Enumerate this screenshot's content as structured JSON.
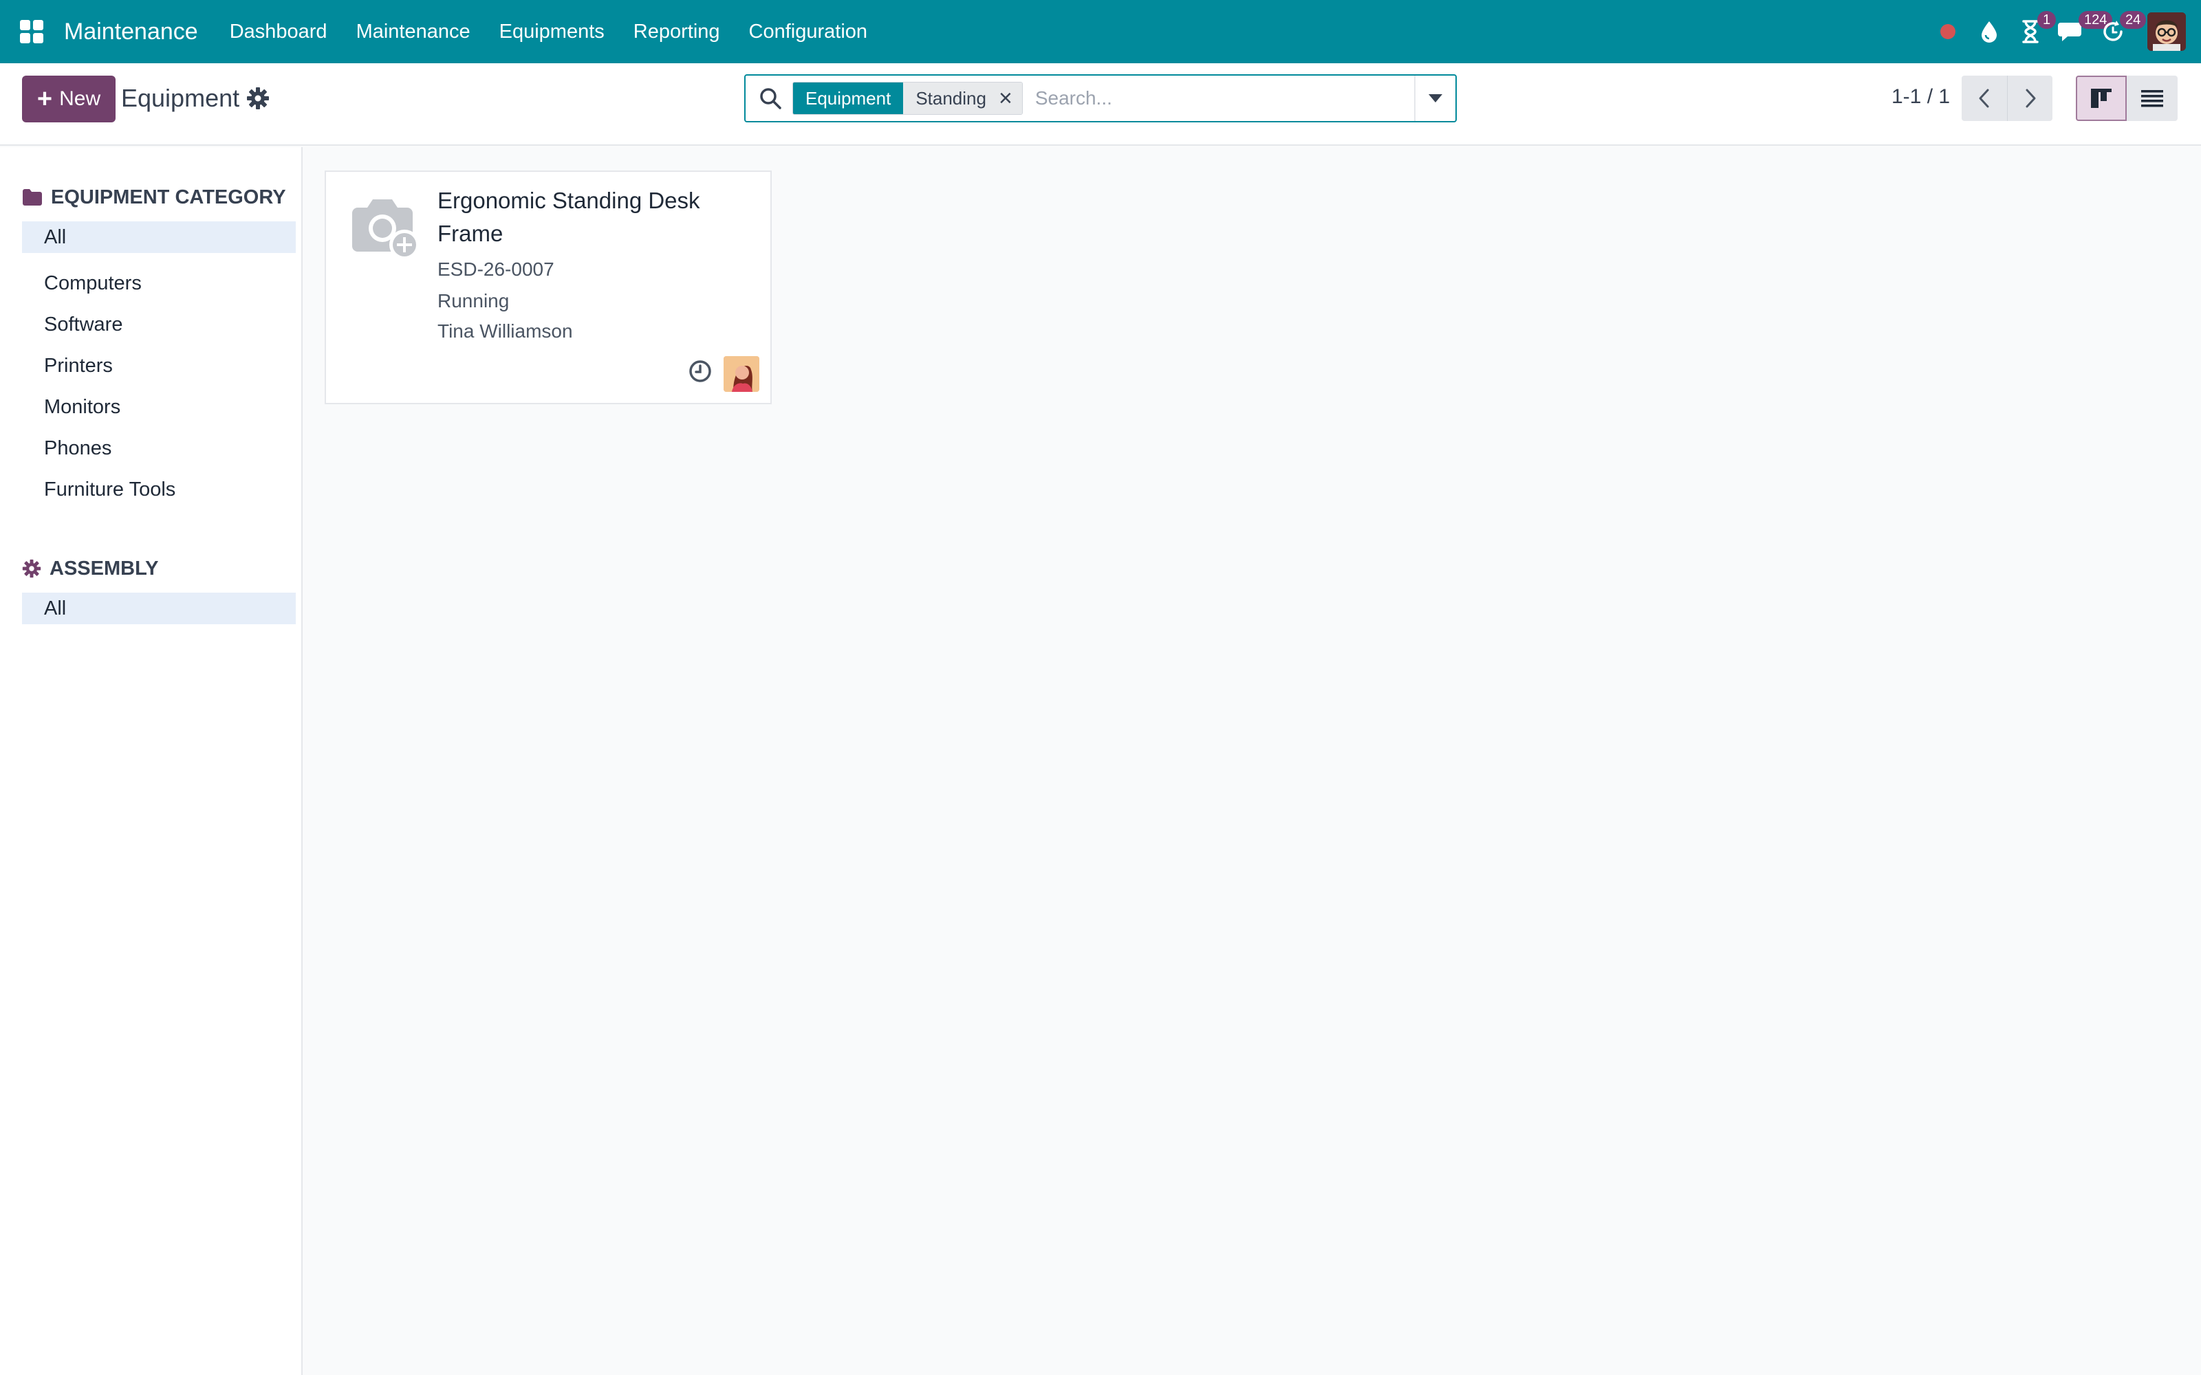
{
  "navbar": {
    "brand": "Maintenance",
    "menu": [
      "Dashboard",
      "Maintenance",
      "Equipments",
      "Reporting",
      "Configuration"
    ],
    "badges": {
      "activities": "1",
      "messages": "124",
      "updates": "24"
    },
    "colors": {
      "background": "#018a9b",
      "badge": "#7d3c75",
      "record": "#d65353"
    }
  },
  "control_panel": {
    "new_label": "New",
    "title": "Equipment",
    "search": {
      "facet_label": "Equipment",
      "facet_value": "Standing",
      "placeholder": "Search..."
    },
    "pager": "1-1 / 1",
    "accent": "#71406b"
  },
  "sidebar": {
    "sections": [
      {
        "header": "EQUIPMENT CATEGORY",
        "icon": "folder-icon",
        "items": [
          "All",
          "Computers",
          "Software",
          "Printers",
          "Monitors",
          "Phones",
          "Furniture Tools"
        ]
      },
      {
        "header": "ASSEMBLY",
        "icon": "gear-icon",
        "items": [
          "All"
        ]
      }
    ]
  },
  "kanban": {
    "cards": [
      {
        "title": "Ergonomic Standing Desk Frame",
        "serial": "ESD-26-0007",
        "status": "Running",
        "technician": "Tina Williamson"
      }
    ]
  }
}
